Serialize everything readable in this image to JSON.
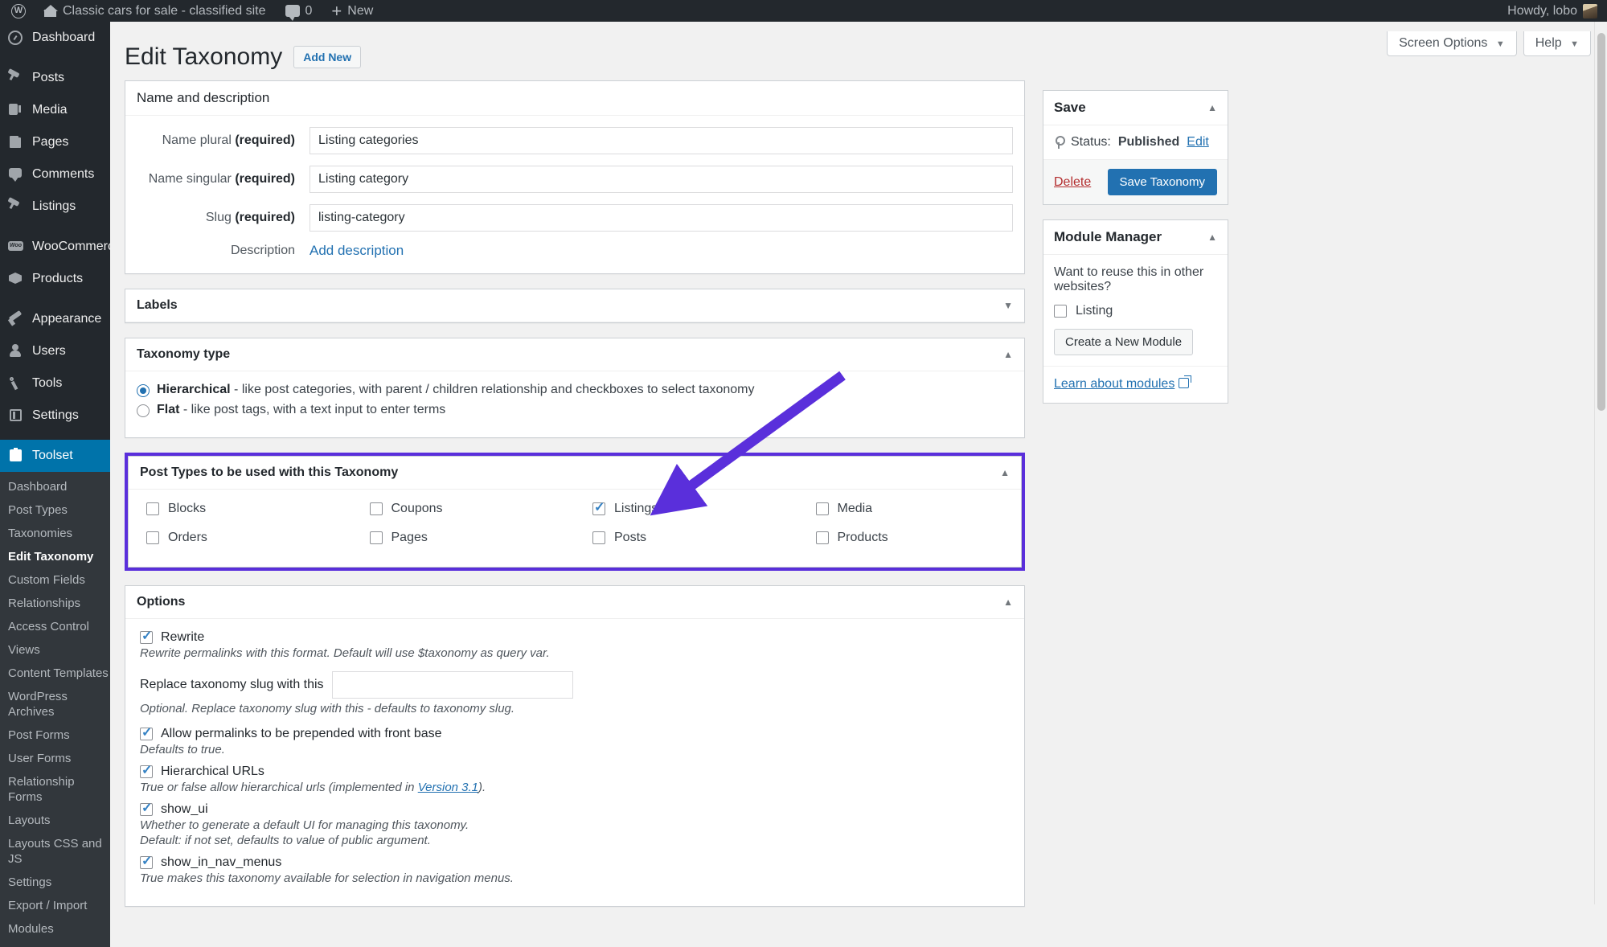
{
  "adminbar": {
    "wp_logo": "wordpress-logo",
    "site_name": "Classic cars for sale - classified site",
    "comment_count": "0",
    "new_label": "New",
    "howdy": "Howdy, lobo"
  },
  "sidebar": {
    "items": [
      {
        "label": "Dashboard",
        "icon": "dashboard-icon"
      },
      {
        "label": "Posts",
        "icon": "pin-icon"
      },
      {
        "label": "Media",
        "icon": "media-icon"
      },
      {
        "label": "Pages",
        "icon": "pages-icon"
      },
      {
        "label": "Comments",
        "icon": "comment-icon"
      },
      {
        "label": "Listings",
        "icon": "pin-icon"
      },
      {
        "label": "WooCommerce",
        "icon": "woocommerce-icon"
      },
      {
        "label": "Products",
        "icon": "products-icon"
      },
      {
        "label": "Appearance",
        "icon": "appearance-icon"
      },
      {
        "label": "Users",
        "icon": "users-icon"
      },
      {
        "label": "Tools",
        "icon": "tools-icon"
      },
      {
        "label": "Settings",
        "icon": "settings-icon"
      },
      {
        "label": "Toolset",
        "icon": "toolset-icon"
      }
    ],
    "submenu": [
      "Dashboard",
      "Post Types",
      "Taxonomies",
      "Edit Taxonomy",
      "Custom Fields",
      "Relationships",
      "Access Control",
      "Views",
      "Content Templates",
      "WordPress Archives",
      "Post Forms",
      "User Forms",
      "Relationship Forms",
      "Layouts",
      "Layouts CSS and JS",
      "Settings",
      "Export / Import",
      "Modules"
    ],
    "active_submenu": "Edit Taxonomy"
  },
  "screen_meta": {
    "screen_options": "Screen Options",
    "help": "Help"
  },
  "header": {
    "title": "Edit Taxonomy",
    "add_new": "Add New"
  },
  "name_box": {
    "title": "Name and description",
    "rows": [
      {
        "label": "Name plural ",
        "required": "(required)",
        "value": "Listing categories"
      },
      {
        "label": "Name singular ",
        "required": "(required)",
        "value": "Listing category"
      },
      {
        "label": "Slug ",
        "required": "(required)",
        "value": "listing-category"
      }
    ],
    "description_label": "Description",
    "description_link": "Add description"
  },
  "labels_box": {
    "title": "Labels"
  },
  "taxonomy_type": {
    "title": "Taxonomy type",
    "options": [
      {
        "name": "Hierarchical",
        "desc": " - like post categories, with parent / children relationship and checkboxes to select taxonomy",
        "selected": true
      },
      {
        "name": "Flat",
        "desc": " - like post tags, with a text input to enter terms",
        "selected": false
      }
    ]
  },
  "post_types": {
    "title": "Post Types to be used with this Taxonomy",
    "highlight_color": "#5a2fdb",
    "items": [
      {
        "label": "Blocks",
        "checked": false
      },
      {
        "label": "Coupons",
        "checked": false
      },
      {
        "label": "Listings",
        "checked": true
      },
      {
        "label": "Media",
        "checked": false
      },
      {
        "label": "Orders",
        "checked": false
      },
      {
        "label": "Pages",
        "checked": false
      },
      {
        "label": "Posts",
        "checked": false
      },
      {
        "label": "Products",
        "checked": false
      }
    ]
  },
  "options": {
    "title": "Options",
    "rewrite": {
      "label": "Rewrite",
      "checked": true,
      "desc": "Rewrite permalinks with this format. Default will use $taxonomy as query var."
    },
    "slug_field": {
      "label": "Replace taxonomy slug with this",
      "value": "",
      "desc": "Optional. Replace taxonomy slug with this - defaults to taxonomy slug."
    },
    "front_base": {
      "label": "Allow permalinks to be prepended with front base",
      "checked": true,
      "desc": "Defaults to true."
    },
    "hierarchical_urls": {
      "label": "Hierarchical URLs",
      "checked": true,
      "desc_pre": "True or false allow hierarchical urls (implemented in ",
      "desc_link": "Version 3.1",
      "desc_post": ")."
    },
    "show_ui": {
      "label": "show_ui",
      "checked": true,
      "desc1": "Whether to generate a default UI for managing this taxonomy.",
      "desc2": "Default: if not set, defaults to value of public argument."
    },
    "show_in_nav_menus": {
      "label": "show_in_nav_menus",
      "checked": true,
      "desc": "True makes this taxonomy available for selection in navigation menus."
    }
  },
  "save_box": {
    "title": "Save",
    "status_prefix": "Status:",
    "status_value": "Published",
    "status_edit": "Edit",
    "delete": "Delete",
    "save_button": "Save Taxonomy"
  },
  "module_manager": {
    "title": "Module Manager",
    "question": "Want to reuse this in other websites?",
    "checkbox_label": "Listing",
    "checkbox_checked": false,
    "create_button": "Create a New Module",
    "learn_link": "Learn about modules"
  }
}
